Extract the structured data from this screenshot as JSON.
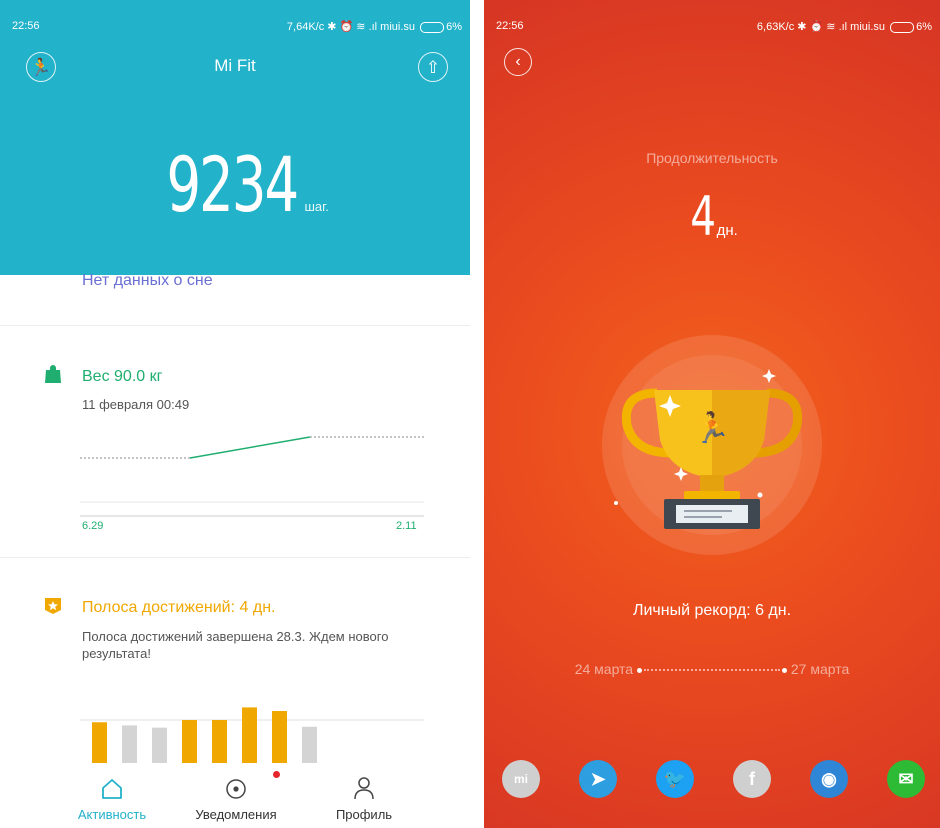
{
  "left": {
    "status": {
      "time": "22:56",
      "info": "7,64K/c ✱ ⏰ ≋ .ıl miui.su",
      "battery": "6%"
    },
    "app_title": "Mi Fit",
    "steps_value": "9234",
    "steps_unit": "шаг.",
    "sleep_text": "Нет данных о сне",
    "weight": {
      "title": "Вес 90.0 кг",
      "date": "11 февраля 00:49",
      "x_start": "6.29",
      "x_end": "2.11",
      "color": "#1fae6f"
    },
    "achievement": {
      "title": "Полоса достижений: 4 дн.",
      "desc": "Полоса достижений завершена 28.3. Ждем нового результата!",
      "color": "#f0a800",
      "bars": [
        {
          "level": 0.95,
          "state": "achieved"
        },
        {
          "level": 0.88,
          "state": "missed"
        },
        {
          "level": 0.83,
          "state": "missed"
        },
        {
          "level": 1.0,
          "state": "achieved"
        },
        {
          "level": 1.0,
          "state": "achieved"
        },
        {
          "level": 1.28,
          "state": "achieved"
        },
        {
          "level": 1.2,
          "state": "achieved"
        },
        {
          "level": 0.85,
          "state": "missed"
        }
      ]
    },
    "nav": [
      {
        "label": "Активность",
        "icon": "home-icon",
        "active": true
      },
      {
        "label": "Уведомления",
        "icon": "notifications-icon",
        "active": false,
        "badge": true
      },
      {
        "label": "Профиль",
        "icon": "profile-icon",
        "active": false
      }
    ],
    "accent": "#22b2c9"
  },
  "right": {
    "status": {
      "time": "22:56",
      "info": "6,63K/c ✱ ⏰ ≋ .ıl miui.su",
      "battery": "6%"
    },
    "duration_label": "Продолжительность",
    "days_value": "4",
    "days_unit": "дн.",
    "record": "Личный рекорд: 6 дн.",
    "date_start": "24 марта",
    "date_end": "27 марта",
    "share_icons": [
      {
        "name": "mi-talk-icon",
        "glyph": "mi",
        "color": "#cfcfcf"
      },
      {
        "name": "telegram-icon",
        "glyph": "➤",
        "color": "#2d9ee0"
      },
      {
        "name": "twitter-icon",
        "glyph": "🐦",
        "color": "#1da1f2"
      },
      {
        "name": "facebook-icon",
        "glyph": "f",
        "color": "#cfcfcf"
      },
      {
        "name": "camera-share-icon",
        "glyph": "◉",
        "color": "#2f86d6"
      },
      {
        "name": "wechat-icon",
        "glyph": "✉",
        "color": "#2dbb36"
      }
    ]
  }
}
